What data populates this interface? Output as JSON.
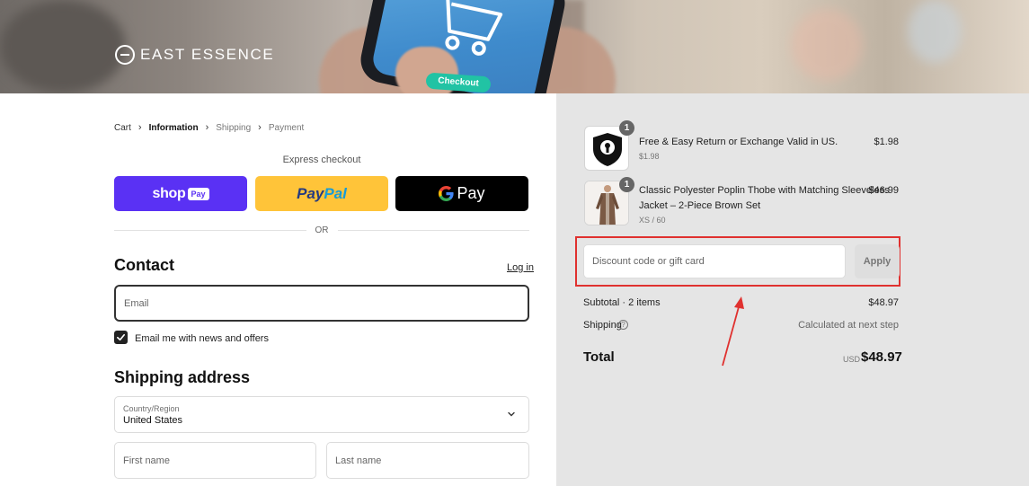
{
  "brand": {
    "name": "EAST ESSENCE"
  },
  "banner": {
    "checkout_label": "Checkout"
  },
  "breadcrumb": [
    "Cart",
    "Information",
    "Shipping",
    "Payment"
  ],
  "express": {
    "label": "Express checkout",
    "shop_pay_word": "shop",
    "shop_pay_badge": "Pay",
    "paypal_part1": "Pay",
    "paypal_part2": "Pal",
    "gpay_text": "Pay"
  },
  "or_text": "OR",
  "contact": {
    "heading": "Contact",
    "login_link": "Log in",
    "email_placeholder": "Email",
    "newsletter_label": "Email me with news and offers",
    "newsletter_checked": true
  },
  "shipping": {
    "heading": "Shipping address",
    "country_label": "Country/Region",
    "country_value": "United States",
    "first_name_placeholder": "First name",
    "last_name_placeholder": "Last name"
  },
  "summary": {
    "items": [
      {
        "name": "Free & Easy Return or Exchange Valid in US.",
        "sub": "$1.98",
        "price": "$1.98",
        "qty": "1",
        "icon": "shield-lock-icon"
      },
      {
        "name_line1": "Classic Polyester Poplin Thobe with Matching Sleeveless",
        "name_line2": "Jacket – 2-Piece Brown Set",
        "sub": "XS / 60",
        "price": "$46.99",
        "qty": "1"
      }
    ],
    "discount_placeholder": "Discount code or gift card",
    "apply_label": "Apply",
    "subtotal_label": "Subtotal · 2 items",
    "subtotal_value": "$48.97",
    "shipping_label": "Shipping",
    "shipping_value": "Calculated at next step",
    "total_label": "Total",
    "currency": "USD",
    "total_value": "$48.97"
  },
  "colors": {
    "shop_pay": "#5a31f4",
    "paypal": "#ffc439",
    "gpay": "#000000",
    "highlight": "#e0312f",
    "summary_bg": "#e5e5e5"
  }
}
